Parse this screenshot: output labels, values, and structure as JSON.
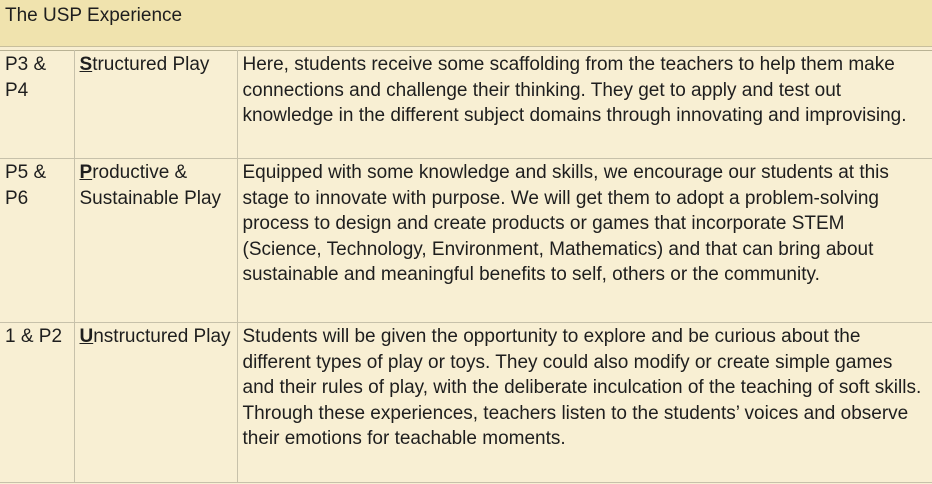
{
  "header": {
    "title": "The USP Experience"
  },
  "rows": [
    {
      "level": "P3 & P4",
      "initial": "S",
      "play_rest": "tructured Play",
      "description": "Here, students receive some scaffolding from the teachers to help them make connections and challenge their thinking. They get to apply and test out knowledge in the different subject domains through innovating and improvising."
    },
    {
      "level": "P5 & P6",
      "initial": "P",
      "play_rest": "roductive & Sustainable Play",
      "description": "Equipped with some knowledge and skills, we encourage our students at this stage to innovate with purpose. We will get them to adopt a problem-solving process to design and create products or games that incorporate STEM (Science, Technology, Environment, Mathematics) and that can bring about sustainable and meaningful benefits to self, others or the community."
    },
    {
      "level": "1 & P2",
      "initial": "U",
      "play_rest": "nstructured Play",
      "description": "Students will be given the opportunity to explore and be curious about the different types of play or toys. They could also modify or create simple games and their rules of play, with the deliberate inculcation of the teaching of soft skills. Through these experiences, teachers listen to the students’ voices and observe their emotions for teachable moments."
    }
  ]
}
